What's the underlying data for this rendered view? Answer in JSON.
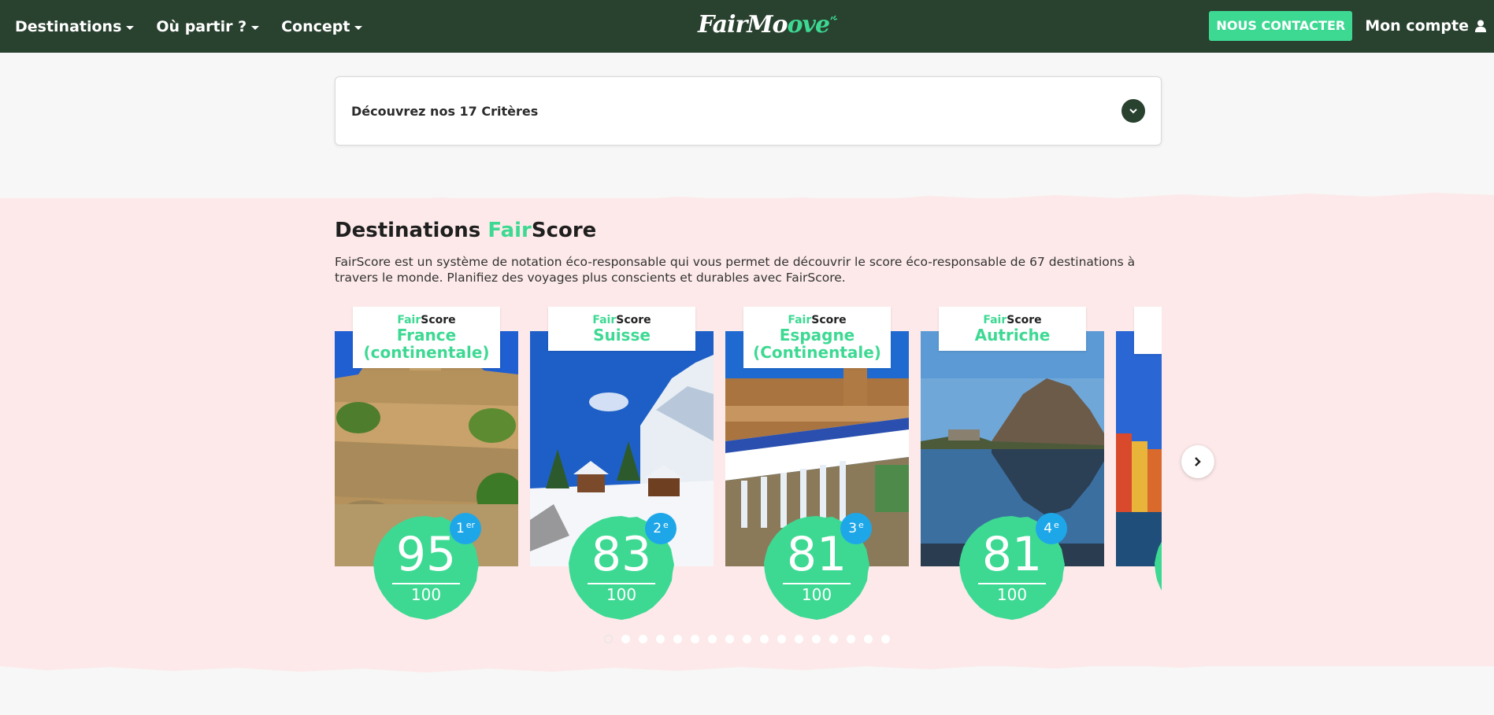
{
  "nav": {
    "items": [
      {
        "label": "Destinations"
      },
      {
        "label": "Où partir ?"
      },
      {
        "label": "Concept"
      }
    ],
    "logo": {
      "part1": "FairMo",
      "part2": "ove"
    },
    "contact_label": "NOUS CONTACTER",
    "account_label": "Mon compte"
  },
  "accordion": {
    "title": "Découvrez nos 17 Critères"
  },
  "section": {
    "title_a": "Destinations ",
    "title_fair": "Fair",
    "title_b": "Score",
    "description": "FairScore est un système de notation éco-responsable qui vous permet de découvrir le score éco-responsable de 67 destinations à travers le monde. Planifiez des voyages plus conscients et durables avec FairScore."
  },
  "brand": {
    "fair": "Fair",
    "score": "Score"
  },
  "cards": [
    {
      "name": "France (continentale)",
      "score": "95",
      "max": "100",
      "rank": "1",
      "rank_suffix": "er"
    },
    {
      "name": "Suisse",
      "score": "83",
      "max": "100",
      "rank": "2",
      "rank_suffix": "e"
    },
    {
      "name": "Espagne (Continentale)",
      "score": "81",
      "max": "100",
      "rank": "3",
      "rank_suffix": "e"
    },
    {
      "name": "Autriche",
      "score": "81",
      "max": "100",
      "rank": "4",
      "rank_suffix": "e"
    }
  ],
  "colors": {
    "nav_bg": "#29412f",
    "accent": "#3dd993",
    "rank_badge": "#1ea7e8",
    "section_bg": "#fde9e9"
  },
  "icons": {
    "account": "user-icon",
    "accordion_toggle": "chevron-down-icon",
    "carousel_next": "chevron-right-icon"
  },
  "carousel": {
    "dot_count": 17,
    "active_dot": 0
  }
}
